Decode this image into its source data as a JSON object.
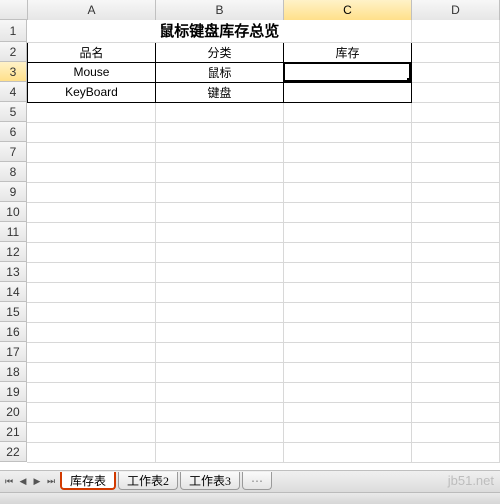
{
  "columns": {
    "A": "A",
    "B": "B",
    "C": "C",
    "D": "D"
  },
  "rows": [
    "1",
    "2",
    "3",
    "4",
    "5",
    "6",
    "7",
    "8",
    "9",
    "10",
    "11",
    "12",
    "13",
    "14",
    "15",
    "16",
    "17",
    "18",
    "19",
    "20",
    "21",
    "22"
  ],
  "active_cell": "C3",
  "title": "鼠标键盘库存总览",
  "table": {
    "headers": {
      "name": "品名",
      "category": "分类",
      "stock": "库存"
    },
    "rows": [
      {
        "name": "Mouse",
        "category": "鼠标",
        "stock": ""
      },
      {
        "name": "KeyBoard",
        "category": "键盘",
        "stock": ""
      }
    ]
  },
  "tabs": {
    "nav": {
      "first": "⏮",
      "prev": "◀",
      "next": "▶",
      "last": "⏭"
    },
    "items": [
      "库存表",
      "工作表2",
      "工作表3"
    ],
    "active_index": 0,
    "ghost": "⋯"
  },
  "watermark": "jb51.net",
  "chart_data": {
    "type": "table",
    "title": "鼠标键盘库存总览",
    "columns": [
      "品名",
      "分类",
      "库存"
    ],
    "rows": [
      [
        "Mouse",
        "鼠标",
        null
      ],
      [
        "KeyBoard",
        "键盘",
        null
      ]
    ]
  }
}
